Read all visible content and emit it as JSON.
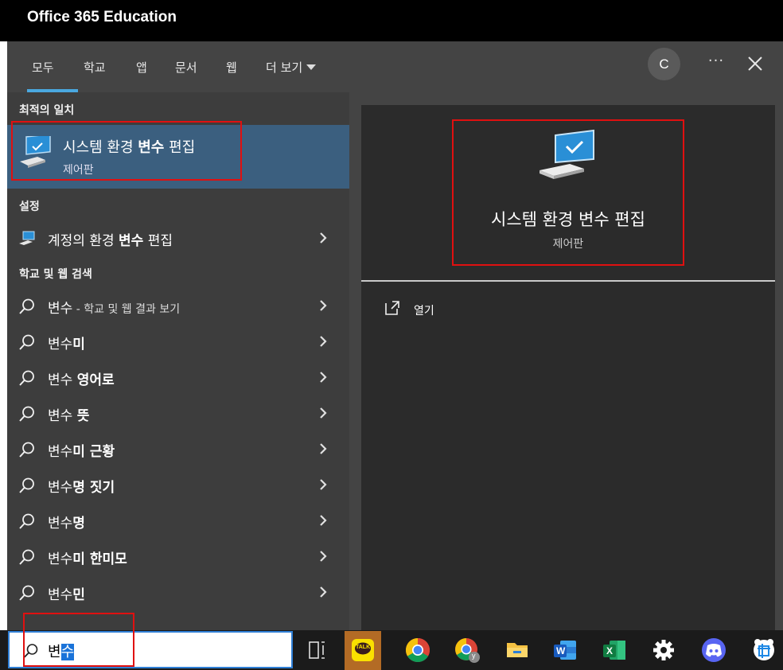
{
  "window": {
    "title": "Office 365 Education"
  },
  "tabs": [
    {
      "label": "모두",
      "active": true
    },
    {
      "label": "학교"
    },
    {
      "label": "앱"
    },
    {
      "label": "문서"
    },
    {
      "label": "웹"
    },
    {
      "label": "더 보기"
    }
  ],
  "header": {
    "avatar_letter": "C",
    "more_label": "···"
  },
  "sections": {
    "best_match": "최적의 일치",
    "settings": "설정",
    "web_search": "학교 및 웹 검색"
  },
  "best_match": {
    "name_pre": "시스템 환경 ",
    "name_bold": "변수",
    "name_post": " 편집",
    "subtitle": "제어판"
  },
  "settings_items": [
    {
      "pre": "계정의 환경 ",
      "bold": "변수",
      "post": " 편집"
    }
  ],
  "web_items": [
    {
      "pre": "변수",
      "bold": "",
      "tail": " - 학교 및 웹 결과 보기"
    },
    {
      "pre": "변수",
      "bold": "미",
      "tail": ""
    },
    {
      "pre": "변수 ",
      "bold": "영어로",
      "tail": ""
    },
    {
      "pre": "변수 ",
      "bold": "뜻",
      "tail": ""
    },
    {
      "pre": "변수",
      "bold": "미 근황",
      "tail": ""
    },
    {
      "pre": "변수",
      "bold": "명 짓기",
      "tail": ""
    },
    {
      "pre": "변수",
      "bold": "명",
      "tail": ""
    },
    {
      "pre": "변수",
      "bold": "미 한미모",
      "tail": ""
    },
    {
      "pre": "변수",
      "bold": "민",
      "tail": ""
    }
  ],
  "detail": {
    "name": "시스템 환경 변수 편집",
    "subtitle": "제어판",
    "open_label": "열기"
  },
  "search": {
    "typed": "변",
    "selected": "수"
  },
  "taskbar": {
    "icons": [
      "task-view-icon",
      "kakaotalk-icon",
      "chrome-icon",
      "chrome-profile-icon",
      "file-explorer-icon",
      "word-icon",
      "excel-icon",
      "settings-gear-icon",
      "discord-icon",
      "capture-app-icon"
    ],
    "kakao_label": "TALK",
    "chrome_badge": "y",
    "word_letter": "W",
    "excel_letter": "X"
  },
  "colors": {
    "accent": "#4aa8e0",
    "highlight": "#3b5f7f",
    "annotation": "#e01010"
  }
}
